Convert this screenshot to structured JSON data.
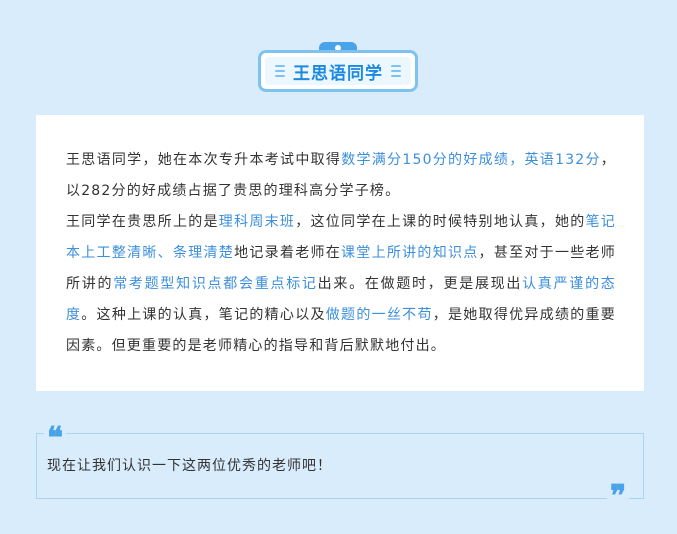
{
  "header": {
    "title": "王思语同学"
  },
  "article": {
    "para1": [
      {
        "text": "王思语同学，她在本次专升本考试中取得",
        "hl": false
      },
      {
        "text": "数学满分150分的好成绩，英语132分",
        "hl": true
      },
      {
        "text": "，以282分的好成绩占据了贵思的理科高分学子榜。",
        "hl": false
      }
    ],
    "para2": [
      {
        "text": "王同学在贵思所上的是",
        "hl": false
      },
      {
        "text": "理科周末班",
        "hl": true
      },
      {
        "text": "，这位同学在上课的时候特别地认真，她的",
        "hl": false
      },
      {
        "text": "笔记本上工整清晰、条理清楚",
        "hl": true
      },
      {
        "text": "地记录着老师在",
        "hl": false
      },
      {
        "text": "课堂上所讲的知识点",
        "hl": true
      },
      {
        "text": "，甚至对于一些老师所讲的",
        "hl": false
      },
      {
        "text": "常考题型知识点都会重点标记",
        "hl": true
      },
      {
        "text": "出来。在做题时，更是展现出",
        "hl": false
      },
      {
        "text": "认真严谨的态度",
        "hl": true
      },
      {
        "text": "。这种上课的认真，笔记的精心以及",
        "hl": false
      },
      {
        "text": "做题的一丝不苟",
        "hl": true
      },
      {
        "text": "，是她取得优异成绩的重要因素。但更重要的是老师精心的指导和背后默默地付出。",
        "hl": false
      }
    ]
  },
  "quote": {
    "open_mark": "❝",
    "close_mark": "❞",
    "text": "现在让我们认识一下这两位优秀的老师吧！"
  },
  "colors": {
    "background": "#d8ecfc",
    "accent": "#3c8fdc",
    "badge_border": "#7ec3f0"
  }
}
